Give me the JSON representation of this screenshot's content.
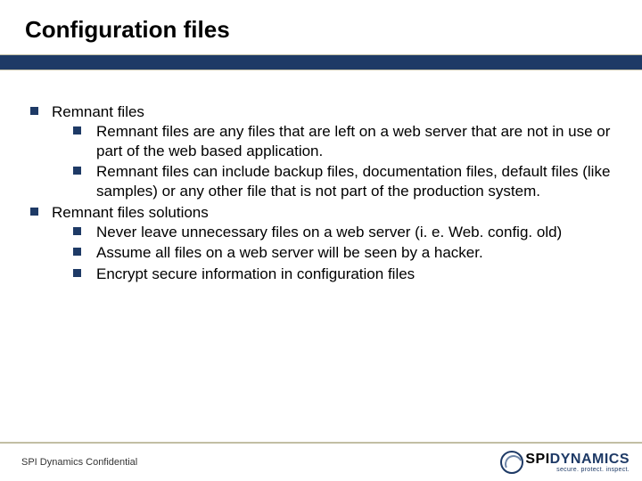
{
  "title": "Configuration files",
  "content": {
    "items": [
      {
        "label": "Remnant files",
        "sub": [
          "Remnant files are any files that are left on a web server that are not in use or part of the web based application.",
          "Remnant files can include backup files, documentation files, default files (like samples) or any other file that is not part of the production system."
        ]
      },
      {
        "label": "Remnant files solutions",
        "sub": [
          "Never leave unnecessary files on a web server (i. e. Web. config. old)",
          "Assume all files on a web server will be seen by a hacker.",
          "Encrypt secure information in configuration files"
        ]
      }
    ]
  },
  "footer": {
    "confidential": "SPI Dynamics Confidential",
    "logo": {
      "brand1": "SPI ",
      "brand2": "DYNAMICS",
      "tagline": "secure. protect. inspect."
    }
  }
}
